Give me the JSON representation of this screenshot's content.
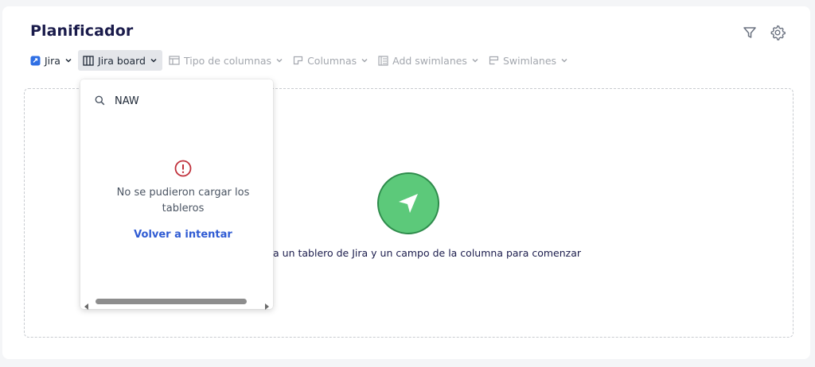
{
  "page": {
    "title": "Planificador"
  },
  "toolbar": {
    "items": [
      {
        "label": "Jira",
        "icon": "jira-icon",
        "state": "normal"
      },
      {
        "label": "Jira board",
        "icon": "board-icon",
        "state": "active"
      },
      {
        "label": "Tipo de columnas",
        "icon": "table-icon",
        "state": "disabled"
      },
      {
        "label": "Columnas",
        "icon": "columns-icon",
        "state": "disabled"
      },
      {
        "label": "Add swimlanes",
        "icon": "add-swimlane-icon",
        "state": "disabled"
      },
      {
        "label": "Swimlanes",
        "icon": "swimlanes-icon",
        "state": "disabled"
      }
    ]
  },
  "top_icons": [
    "filter-icon",
    "gear-icon"
  ],
  "empty_state": {
    "icon": "send-arrow-icon",
    "text": "iona un tablero de Jira y un campo de la columna para comenzar",
    "icon_color": "#5cc97a"
  },
  "dropdown": {
    "search_value": "NAW",
    "error_text": "No se pudieron cargar los tableros",
    "retry_label": "Volver a intentar",
    "error_color": "#c0303b",
    "link_color": "#2f5bd3"
  }
}
